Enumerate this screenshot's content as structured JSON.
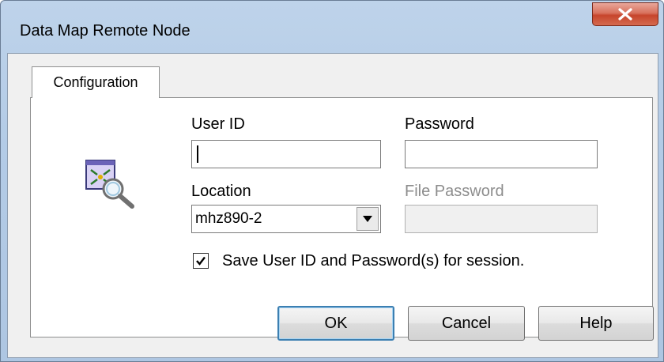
{
  "window": {
    "title": "Data Map Remote Node"
  },
  "tabs": [
    {
      "label": "Configuration"
    }
  ],
  "form": {
    "user_id_label": "User ID",
    "user_id_value": "",
    "password_label": "Password",
    "password_value": "",
    "location_label": "Location",
    "location_value": "mhz890-2",
    "file_password_label": "File Password",
    "file_password_value": "",
    "save_checkbox_label": "Save User ID and Password(s) for session.",
    "save_checkbox_checked": true
  },
  "buttons": {
    "ok": "OK",
    "cancel": "Cancel",
    "help": "Help"
  },
  "icons": {
    "close": "close-icon",
    "app": "remote-node-magnifier-icon",
    "dropdown": "chevron-down-icon",
    "check": "checkmark-icon"
  },
  "colors": {
    "titlebar": "#b3cbe6",
    "close_button": "#c7452c",
    "default_button_border": "#3c7fb1"
  }
}
